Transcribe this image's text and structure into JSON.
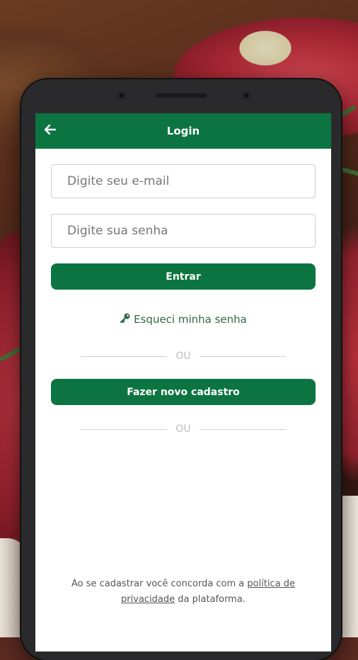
{
  "app_bar": {
    "title": "Login",
    "back_icon": "arrow-left-icon"
  },
  "form": {
    "email_placeholder": "Digite seu e-mail",
    "email_value": "",
    "password_placeholder": "Digite sua senha",
    "password_value": ""
  },
  "buttons": {
    "login": "Entrar",
    "signup": "Fazer novo cadastro"
  },
  "forgot_password": {
    "icon": "key-icon",
    "label": "Esqueci minha senha"
  },
  "dividers": {
    "first": "OU",
    "second": "OU"
  },
  "terms": {
    "prefix": "Ao se cadastrar você concorda com a ",
    "link_part1": "política de",
    "link_part2": "privacidade",
    "suffix": " da plataforma."
  },
  "colors": {
    "primary": "#0c7440",
    "link": "#2e6b45"
  }
}
